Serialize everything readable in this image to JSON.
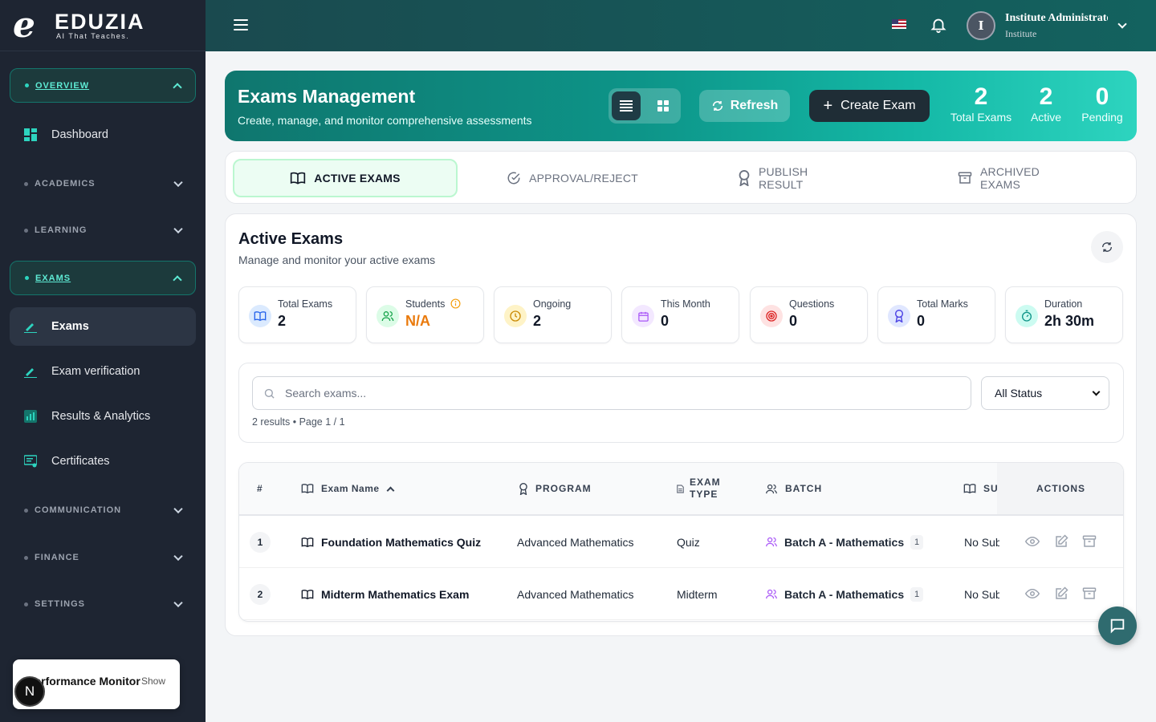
{
  "brand": {
    "name": "EDUZIA",
    "tagline": "AI That Teaches."
  },
  "sidebar": {
    "overview_label": "OVERVIEW",
    "dashboard_label": "Dashboard",
    "academics_label": "ACADEMICS",
    "learning_label": "LEARNING",
    "exams_label": "EXAMS",
    "exams_items": [
      "Exams",
      "Exam verification",
      "Results & Analytics",
      "Certificates"
    ],
    "communication_label": "COMMUNICATION",
    "finance_label": "FINANCE",
    "settings_label": "SETTINGS",
    "accent_color": "#2dd4bf"
  },
  "perf_monitor": {
    "title": "Performance Monitor",
    "toggle": "Show",
    "badge": "N"
  },
  "header": {
    "user_initial": "I",
    "user_name": "Institute Administrator",
    "user_role": "Institute"
  },
  "banner": {
    "title": "Exams Management",
    "subtitle": "Create, manage, and monitor comprehensive assessments",
    "refresh_label": "Refresh",
    "create_label": "Create Exam",
    "stats": [
      {
        "value": "2",
        "label": "Total Exams"
      },
      {
        "value": "2",
        "label": "Active"
      },
      {
        "value": "0",
        "label": "Pending"
      }
    ]
  },
  "tabs": [
    "ACTIVE EXAMS",
    "APPROVAL/REJECT",
    "PUBLISH RESULT",
    "ARCHIVED EXAMS"
  ],
  "card": {
    "title": "Active Exams",
    "subtitle": "Manage and monitor your active exams",
    "metrics": [
      {
        "label": "Total Exams",
        "value": "2"
      },
      {
        "label": "Students",
        "value": "N/A"
      },
      {
        "label": "Ongoing",
        "value": "2"
      },
      {
        "label": "This Month",
        "value": "0"
      },
      {
        "label": "Questions",
        "value": "0"
      },
      {
        "label": "Total Marks",
        "value": "0"
      },
      {
        "label": "Duration",
        "value": "2h 30m"
      }
    ],
    "search_placeholder": "Search exams...",
    "status_filter": "All Status",
    "results_text": "2 results • Page 1 / 1"
  },
  "table": {
    "headers": {
      "num": "#",
      "name": "Exam Name",
      "program": "PROGRAM",
      "type_line1": "EXAM",
      "type_line2": "TYPE",
      "batch": "BATCH",
      "subject": "SU",
      "actions": "ACTIONS"
    },
    "rows": [
      {
        "num": "1",
        "name": "Foundation Mathematics Quiz",
        "program": "Advanced Mathematics",
        "type": "Quiz",
        "batch": "Batch A - Mathematics",
        "batch_count": "1",
        "subject": "No Sub"
      },
      {
        "num": "2",
        "name": "Midterm Mathematics Exam",
        "program": "Advanced Mathematics",
        "type": "Midterm",
        "batch": "Batch A - Mathematics",
        "batch_count": "1",
        "subject": "No Sub"
      }
    ]
  }
}
